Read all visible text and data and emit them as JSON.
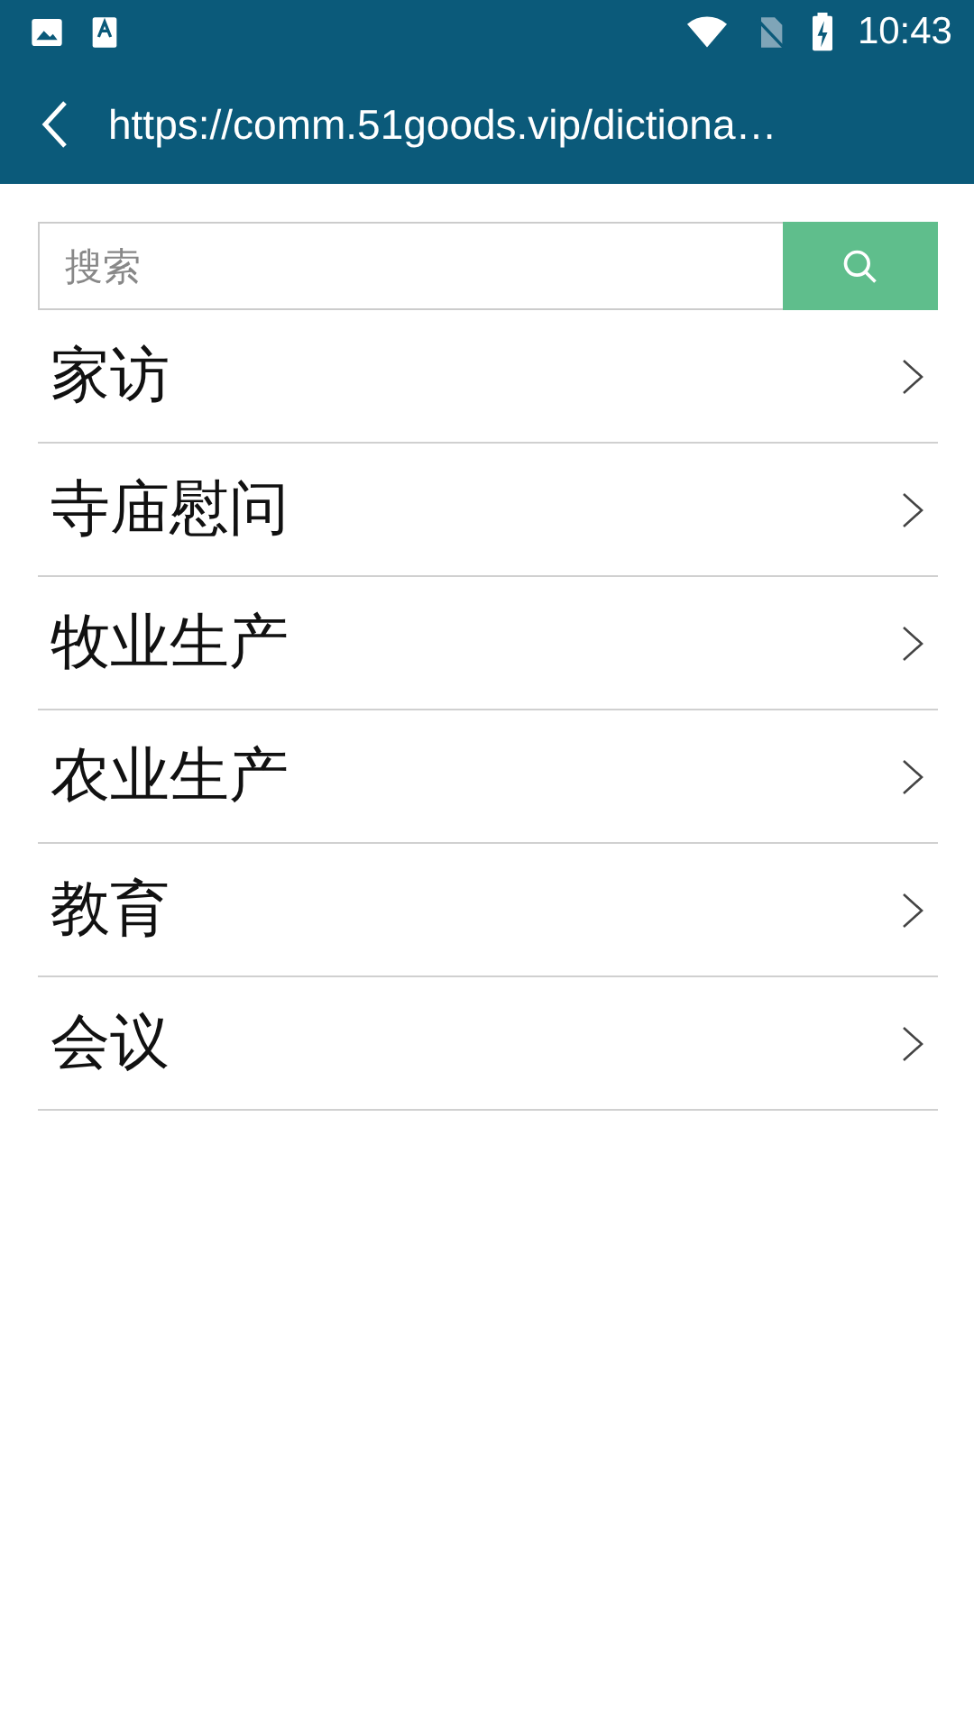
{
  "status_bar": {
    "time": "10:43"
  },
  "header": {
    "title": "https://comm.51goods.vip/dictiona…"
  },
  "search": {
    "placeholder": "搜索"
  },
  "items": [
    {
      "label": "家访"
    },
    {
      "label": "寺庙慰问"
    },
    {
      "label": "牧业生产"
    },
    {
      "label": "农业生产"
    },
    {
      "label": "教育"
    },
    {
      "label": "会议"
    }
  ]
}
